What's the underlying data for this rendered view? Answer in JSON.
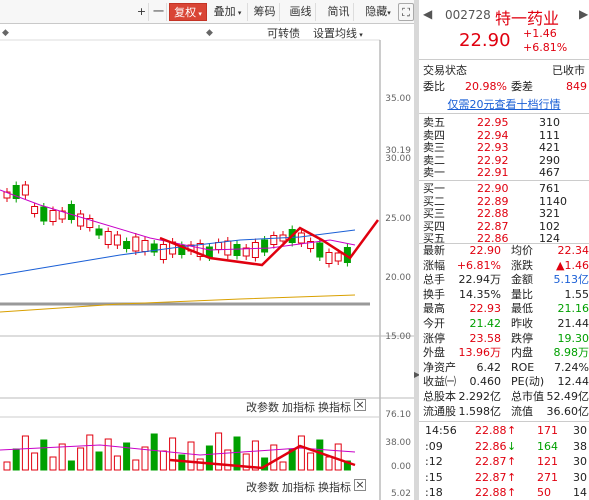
{
  "toolbar": {
    "plus": "+",
    "minus": "一",
    "fuquan": "复权",
    "diejia": "叠加",
    "choumа": "筹码",
    "huaxian": "画线",
    "jiaxun": "简讯",
    "yincang": "隐藏"
  },
  "chart_header": {
    "kezhuanzhai": "可转债",
    "shezhi": "设置均线"
  },
  "price_axis": {
    "t1": "35.00",
    "t2": "30.19",
    "t3": "30.00",
    "t4": "25.00",
    "t5": "20.00",
    "t6": "15.00"
  },
  "vol_toolbar": {
    "gai": "改参数",
    "jia": "加指标",
    "huan": "换指标",
    "close": "×"
  },
  "vol_axis": {
    "t1": "76.10",
    "t2": "38.00",
    "t3": "0.00",
    "t4": "5.02"
  },
  "stock": {
    "code": "002728",
    "name": "特一药业",
    "price": "22.90",
    "change": "+1.46",
    "pct": "+6.81%"
  },
  "status": {
    "label": "交易状态",
    "value": "已收市"
  },
  "weibi": {
    "label": "委比",
    "value": "20.98%",
    "wc_label": "委差",
    "wc_value": "849"
  },
  "promo": "仅需20元查看十档行情",
  "sells": [
    {
      "name": "卖五",
      "price": "22.95",
      "vol": "310"
    },
    {
      "name": "卖四",
      "price": "22.94",
      "vol": "111"
    },
    {
      "name": "卖三",
      "price": "22.93",
      "vol": "421"
    },
    {
      "name": "卖二",
      "price": "22.92",
      "vol": "290"
    },
    {
      "name": "卖一",
      "price": "22.91",
      "vol": "467"
    }
  ],
  "buys": [
    {
      "name": "买一",
      "price": "22.90",
      "vol": "761"
    },
    {
      "name": "买二",
      "price": "22.89",
      "vol": "1140"
    },
    {
      "name": "买三",
      "price": "22.88",
      "vol": "321"
    },
    {
      "name": "买四",
      "price": "22.87",
      "vol": "102"
    },
    {
      "name": "买五",
      "price": "22.86",
      "vol": "124"
    }
  ],
  "stats": [
    {
      "l1": "最新",
      "v1": "22.90",
      "l2": "均价",
      "v2": "22.34"
    },
    {
      "l1": "涨幅",
      "v1": "+6.81%",
      "l2": "涨跌",
      "v2": "▲1.46"
    },
    {
      "l1": "总手",
      "v1": "22.94万",
      "l2": "金额",
      "v2": "5.13亿"
    },
    {
      "l1": "换手",
      "v1": "14.35%",
      "l2": "量比",
      "v2": "1.55"
    },
    {
      "l1": "最高",
      "v1": "22.93",
      "l2": "最低",
      "v2": "21.16"
    },
    {
      "l1": "今开",
      "v1": "21.42",
      "l2": "昨收",
      "v2": "21.44"
    },
    {
      "l1": "涨停",
      "v1": "23.58",
      "l2": "跌停",
      "v2": "19.30"
    },
    {
      "l1": "外盘",
      "v1": "13.96万",
      "l2": "内盘",
      "v2": "8.98万"
    },
    {
      "l1": "净资产",
      "v1": "6.42",
      "l2": "ROE",
      "v2": "7.24%"
    },
    {
      "l1": "收益㈠",
      "v1": "0.460",
      "l2": "PE(动)",
      "v2": "12.44"
    },
    {
      "l1": "总股本",
      "v1": "2.292亿",
      "l2": "总市值",
      "v2": "52.49亿"
    },
    {
      "l1": "流通股",
      "v1": "1.598亿",
      "l2": "流值",
      "v2": "36.60亿"
    }
  ],
  "ticks": [
    {
      "t": "14:56",
      "p": "22.88",
      "v": "171",
      "n": "30"
    },
    {
      "t": ":09",
      "p": "22.86",
      "v": "164",
      "n": "38"
    },
    {
      "t": ":12",
      "p": "22.87",
      "v": "121",
      "n": "30"
    },
    {
      "t": ":15",
      "p": "22.87",
      "v": "271",
      "n": "30"
    },
    {
      "t": ":18",
      "p": "22.88",
      "v": "50",
      "n": "14"
    }
  ]
}
